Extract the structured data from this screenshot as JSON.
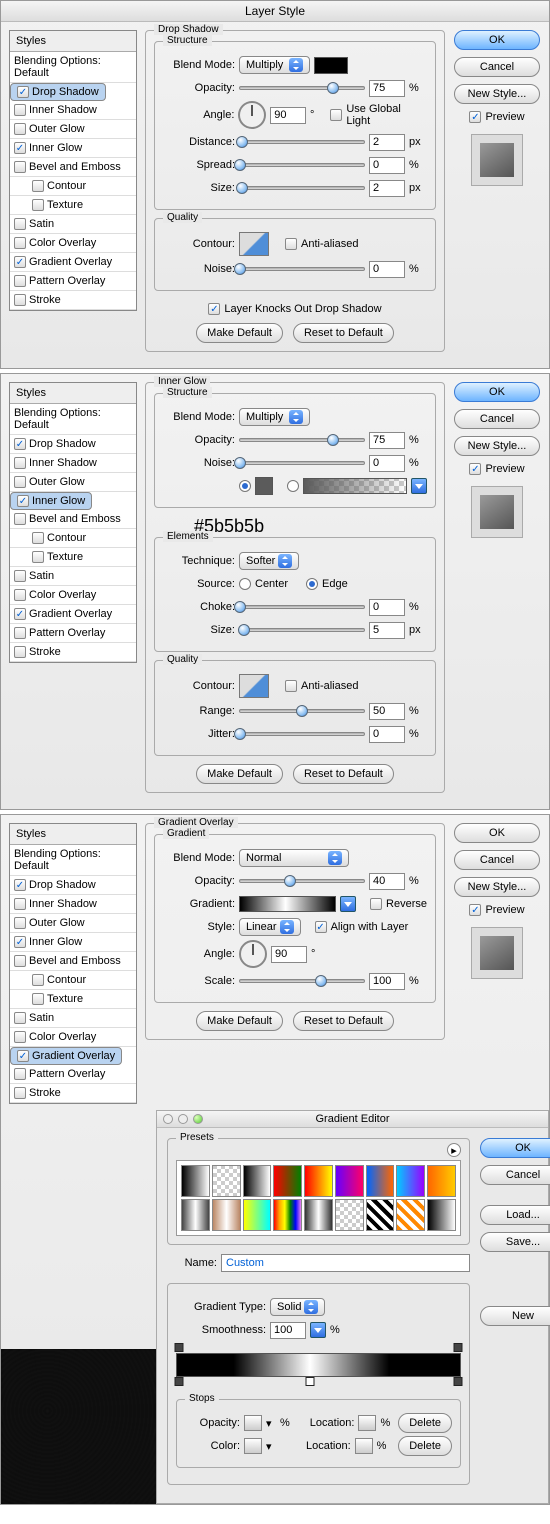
{
  "window_title": "Layer Style",
  "styles_header": "Styles",
  "blending_opts": "Blending Options: Default",
  "style_items": [
    {
      "label": "Drop Shadow",
      "checked": true
    },
    {
      "label": "Inner Shadow",
      "checked": false
    },
    {
      "label": "Outer Glow",
      "checked": false
    },
    {
      "label": "Inner Glow",
      "checked": true
    },
    {
      "label": "Bevel and Emboss",
      "checked": false
    },
    {
      "label": "Contour",
      "checked": false,
      "indent": true
    },
    {
      "label": "Texture",
      "checked": false,
      "indent": true
    },
    {
      "label": "Satin",
      "checked": false
    },
    {
      "label": "Color Overlay",
      "checked": false
    },
    {
      "label": "Gradient Overlay",
      "checked": true
    },
    {
      "label": "Pattern Overlay",
      "checked": false
    },
    {
      "label": "Stroke",
      "checked": false
    }
  ],
  "buttons": {
    "ok": "OK",
    "cancel": "Cancel",
    "newstyle": "New Style...",
    "preview": "Preview",
    "make_default": "Make Default",
    "reset_default": "Reset to Default",
    "load": "Load...",
    "save": "Save...",
    "new": "New",
    "delete": "Delete"
  },
  "sections": {
    "drop_shadow": {
      "title": "Drop Shadow",
      "structure": "Structure",
      "quality": "Quality",
      "blend_mode_lbl": "Blend Mode:",
      "blend_mode": "Multiply",
      "opacity_lbl": "Opacity:",
      "opacity": "75",
      "opacity_u": "%",
      "angle_lbl": "Angle:",
      "angle": "90",
      "angle_u": "°",
      "global": "Use Global Light",
      "distance_lbl": "Distance:",
      "distance": "2",
      "distance_u": "px",
      "spread_lbl": "Spread:",
      "spread": "0",
      "spread_u": "%",
      "size_lbl": "Size:",
      "size": "2",
      "size_u": "px",
      "contour_lbl": "Contour:",
      "aa": "Anti-aliased",
      "noise_lbl": "Noise:",
      "noise": "0",
      "noise_u": "%",
      "knock": "Layer Knocks Out Drop Shadow"
    },
    "inner_glow": {
      "title": "Inner Glow",
      "structure": "Structure",
      "elements": "Elements",
      "quality": "Quality",
      "blend_mode_lbl": "Blend Mode:",
      "blend_mode": "Multiply",
      "opacity_lbl": "Opacity:",
      "opacity": "75",
      "opacity_u": "%",
      "noise_lbl": "Noise:",
      "noise": "0",
      "noise_u": "%",
      "color_note": "#5b5b5b",
      "technique_lbl": "Technique:",
      "technique": "Softer",
      "source_lbl": "Source:",
      "center": "Center",
      "edge": "Edge",
      "choke_lbl": "Choke:",
      "choke": "0",
      "choke_u": "%",
      "size_lbl": "Size:",
      "size": "5",
      "size_u": "px",
      "contour_lbl": "Contour:",
      "aa": "Anti-aliased",
      "range_lbl": "Range:",
      "range": "50",
      "range_u": "%",
      "jitter_lbl": "Jitter:",
      "jitter": "0",
      "jitter_u": "%"
    },
    "grad_overlay": {
      "title": "Gradient Overlay",
      "gradient": "Gradient",
      "blend_mode_lbl": "Blend Mode:",
      "blend_mode": "Normal",
      "opacity_lbl": "Opacity:",
      "opacity": "40",
      "opacity_u": "%",
      "gradient_lbl": "Gradient:",
      "reverse": "Reverse",
      "style_lbl": "Style:",
      "style": "Linear",
      "align": "Align with Layer",
      "angle_lbl": "Angle:",
      "angle": "90",
      "angle_u": "°",
      "scale_lbl": "Scale:",
      "scale": "100",
      "scale_u": "%"
    }
  },
  "gradient_editor": {
    "title": "Gradient Editor",
    "presets": "Presets",
    "name_lbl": "Name:",
    "name": "Custom",
    "type_lbl": "Gradient Type:",
    "type": "Solid",
    "smooth_lbl": "Smoothness:",
    "smooth": "100",
    "smooth_u": "%",
    "stops": "Stops",
    "opacity_lbl": "Opacity:",
    "location_lbl": "Location:",
    "color_lbl": "Color:",
    "pct": "%"
  }
}
